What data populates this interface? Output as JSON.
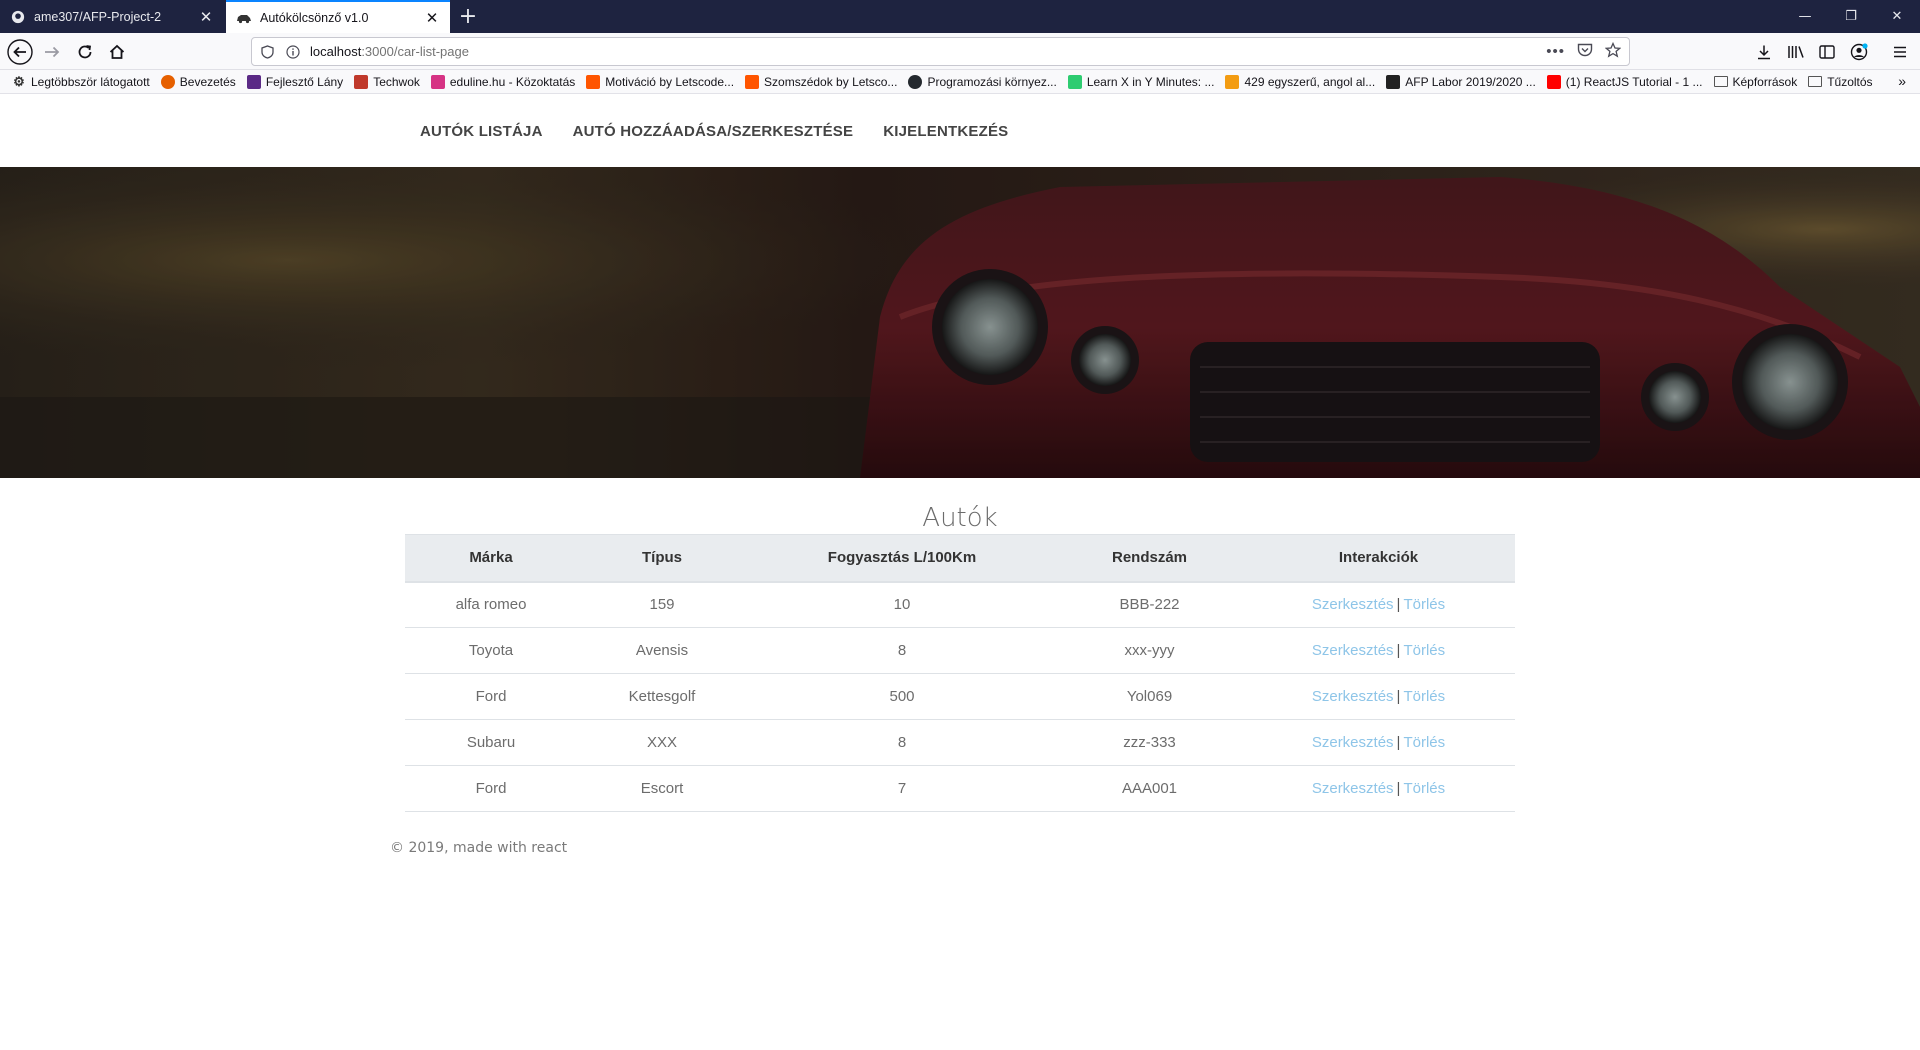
{
  "browser": {
    "tabs": [
      {
        "label": "ame307/AFP-Project-2",
        "icon": "github-icon",
        "active": false
      },
      {
        "label": "Autókölcsönző v1.0",
        "icon": "car-icon",
        "active": true
      }
    ],
    "url_host": "localhost",
    "url_path": ":3000/car-list-page",
    "bookmarks": [
      {
        "label": "Legtöbbször látogatott",
        "icon": "gear-icon",
        "color": "#333333"
      },
      {
        "label": "Bevezetés",
        "icon": "firefox-icon",
        "color": "#e66000"
      },
      {
        "label": "Fejlesztő Lány",
        "icon": "f-icon",
        "color": "#5b2a86"
      },
      {
        "label": "Techwok",
        "icon": "techwok-icon",
        "color": "#c0392b"
      },
      {
        "label": "eduline.hu - Közoktatás",
        "icon": "e-icon",
        "color": "#d63384"
      },
      {
        "label": "Motiváció by Letscode...",
        "icon": "soundcloud-icon",
        "color": "#ff5500"
      },
      {
        "label": "Szomszédok by Letsco...",
        "icon": "soundcloud-icon",
        "color": "#ff5500"
      },
      {
        "label": "Programozási környez...",
        "icon": "github-icon",
        "color": "#24292e"
      },
      {
        "label": "Learn X in Y Minutes: ...",
        "icon": "x-icon",
        "color": "#2ecc71"
      },
      {
        "label": "429 egyszerű, angol al...",
        "icon": "b-icon",
        "color": "#f39c12"
      },
      {
        "label": "AFP Labor 2019/2020 ...",
        "icon": "notion-icon",
        "color": "#222222"
      },
      {
        "label": "(1) ReactJS Tutorial - 1 ...",
        "icon": "youtube-icon",
        "color": "#ff0000"
      },
      {
        "label": "Képforrások",
        "icon": "folder-icon",
        "color": "#555555"
      },
      {
        "label": "Tűzoltós",
        "icon": "folder-icon",
        "color": "#555555"
      }
    ]
  },
  "site": {
    "nav": [
      "AUTÓK LISTÁJA",
      "AUTÓ HOZZÁADÁSA/SZERKESZTÉSE",
      "KIJELENTKEZÉS"
    ],
    "title": "Autók",
    "table": {
      "headers": [
        "Márka",
        "Típus",
        "Fogyasztás L/100Km",
        "Rendszám",
        "Interakciók"
      ],
      "rows": [
        [
          "alfa romeo",
          "159",
          "10",
          "BBB-222"
        ],
        [
          "Toyota",
          "Avensis",
          "8",
          "xxx-yyy"
        ],
        [
          "Ford",
          "Kettesgolf",
          "500",
          "Yol069"
        ],
        [
          "Subaru",
          "XXX",
          "8",
          "zzz-333"
        ],
        [
          "Ford",
          "Escort",
          "7",
          "AAA001"
        ]
      ],
      "edit_label": "Szerkesztés",
      "delete_label": "Törlés",
      "separator": "|"
    },
    "footer": "© 2019, made with react"
  }
}
